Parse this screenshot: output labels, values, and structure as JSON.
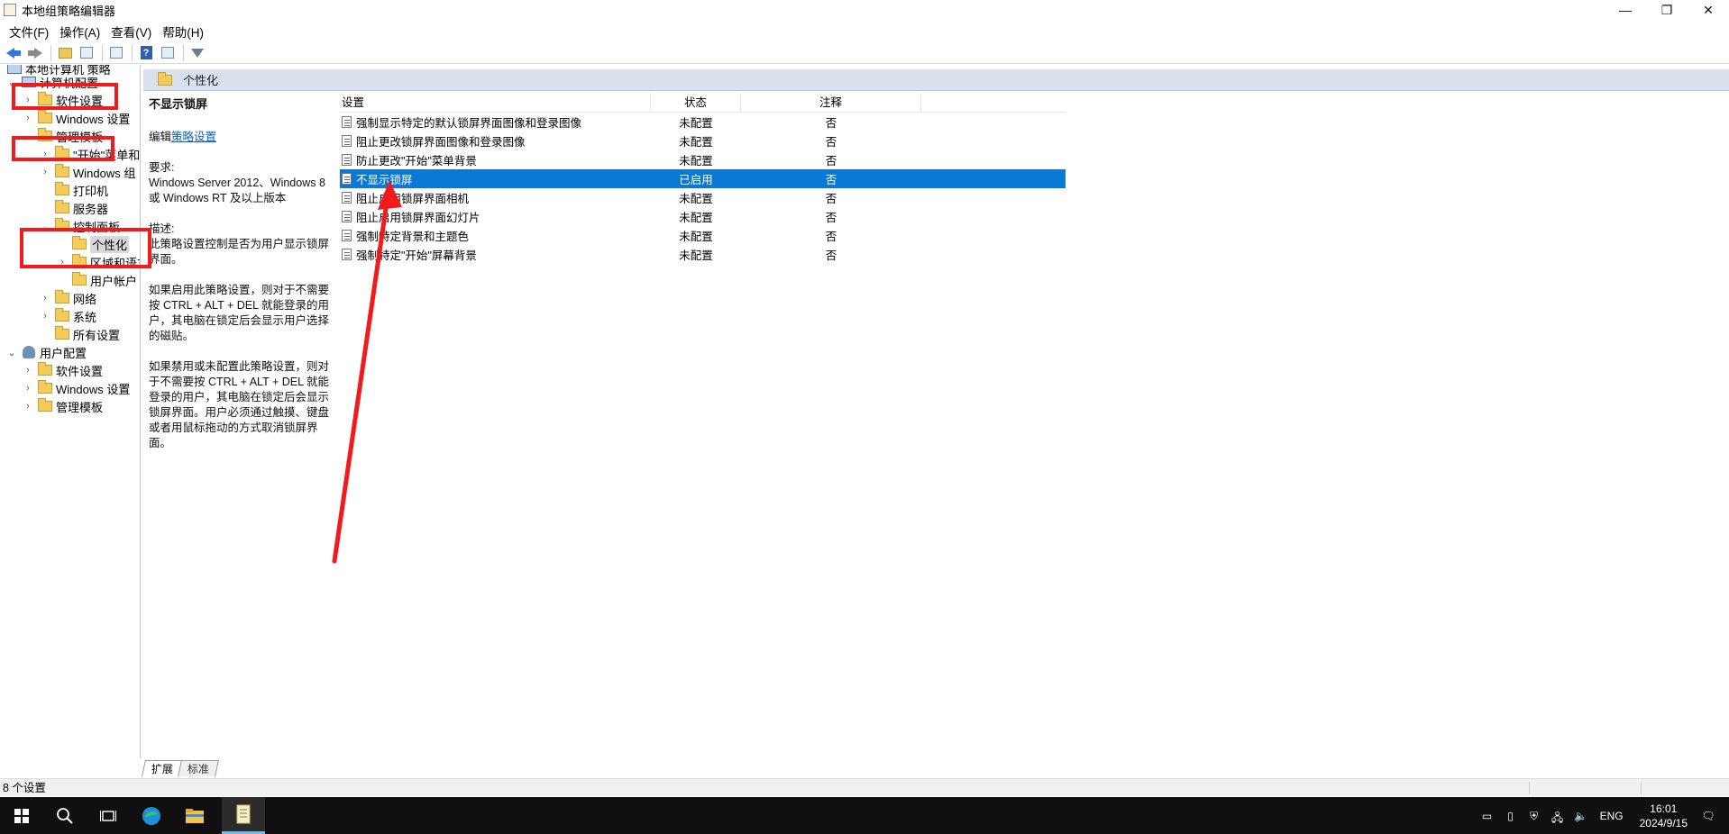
{
  "window": {
    "title": "本地组策略编辑器"
  },
  "menu": [
    "文件(F)",
    "操作(A)",
    "查看(V)",
    "帮助(H)"
  ],
  "tree": {
    "root": "本地计算机 策略",
    "computer_config": "计算机配置",
    "software_settings": "软件设置",
    "windows_settings": "Windows 设置",
    "admin_templates": "管理模板",
    "start_menu": "\"开始\"菜单和",
    "windows_components": "Windows 组",
    "printers": "打印机",
    "server": "服务器",
    "control_panel": "控制面板",
    "personalization": "个性化",
    "region_language": "区域和语言",
    "user_accounts": "用户帐户",
    "network": "网络",
    "system": "系统",
    "all_settings": "所有设置",
    "user_config": "用户配置",
    "user_software_settings": "软件设置",
    "user_windows_settings": "Windows 设置",
    "user_admin_templates": "管理模板"
  },
  "header": {
    "title": "个性化"
  },
  "description": {
    "title": "不显示锁屏",
    "edit_prefix": "编辑",
    "edit_link": "策略设置",
    "requirements_label": "要求:",
    "requirements": "Windows Server 2012、Windows 8 或 Windows RT 及以上版本",
    "desc_label": "描述:",
    "desc1": "此策略设置控制是否为用户显示锁屏界面。",
    "desc2": "如果启用此策略设置，则对于不需要按 CTRL + ALT + DEL 就能登录的用户，其电脑在锁定后会显示用户选择的磁贴。",
    "desc3": "如果禁用或未配置此策略设置，则对于不需要按 CTRL + ALT + DEL 就能登录的用户，其电脑在锁定后会显示锁屏界面。用户必须通过触摸、键盘或者用鼠标拖动的方式取消锁屏界面。"
  },
  "list": {
    "headers": {
      "setting": "设置",
      "state": "状态",
      "comment": "注释"
    },
    "rows": [
      {
        "setting": "强制显示特定的默认锁屏界面图像和登录图像",
        "state": "未配置",
        "comment": "否"
      },
      {
        "setting": "阻止更改锁屏界面图像和登录图像",
        "state": "未配置",
        "comment": "否"
      },
      {
        "setting": "防止更改\"开始\"菜单背景",
        "state": "未配置",
        "comment": "否"
      },
      {
        "setting": "不显示锁屏",
        "state": "已启用",
        "comment": "否"
      },
      {
        "setting": "阻止启用锁屏界面相机",
        "state": "未配置",
        "comment": "否"
      },
      {
        "setting": "阻止启用锁屏界面幻灯片",
        "state": "未配置",
        "comment": "否"
      },
      {
        "setting": "强制特定背景和主题色",
        "state": "未配置",
        "comment": "否"
      },
      {
        "setting": "强制特定\"开始\"屏幕背景",
        "state": "未配置",
        "comment": "否"
      }
    ]
  },
  "tabs": [
    "扩展",
    "标准"
  ],
  "status": {
    "text": "8 个设置"
  },
  "taskbar": {
    "lang": "ENG",
    "time": "16:01",
    "date": "2024/9/15"
  },
  "colors": {
    "selection": "#0a78d7",
    "annotation": "#f21a1a"
  }
}
